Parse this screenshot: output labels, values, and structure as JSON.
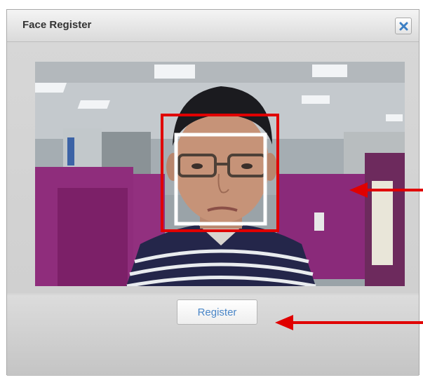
{
  "dialog": {
    "title": "Face Register",
    "close_icon": "close-x-icon",
    "register_label": "Register"
  },
  "colors": {
    "detection_box": "#e00000",
    "face_box": "#ffffff",
    "arrow": "#e00000",
    "button_text": "#4a86c8"
  }
}
